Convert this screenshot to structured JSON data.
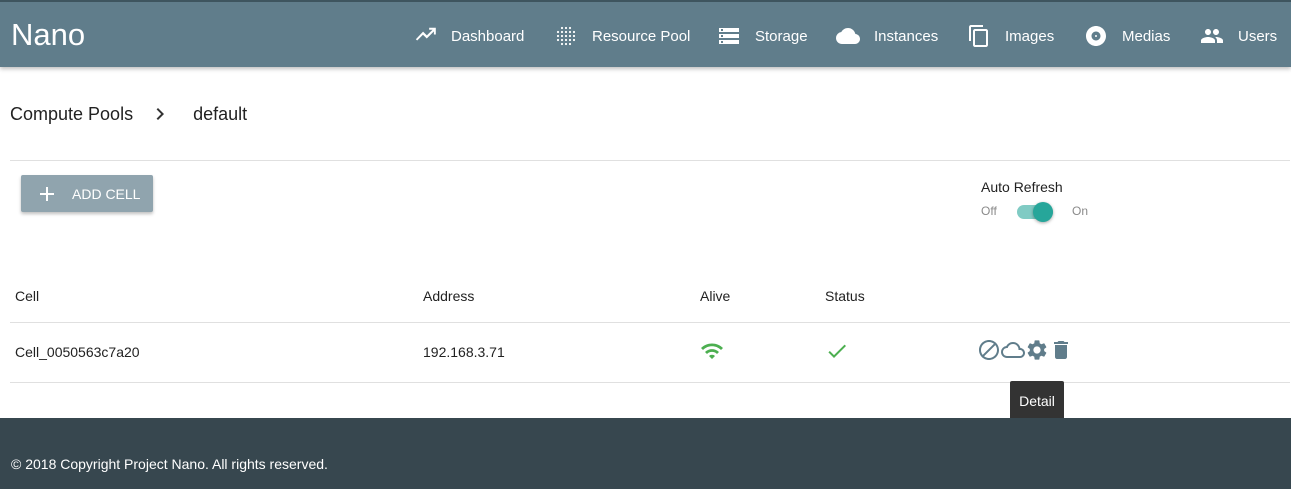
{
  "header": {
    "brand": "Nano",
    "nav": [
      {
        "label": "Dashboard",
        "icon": "trending-icon"
      },
      {
        "label": "Resource Pool",
        "icon": "grid-dots-icon"
      },
      {
        "label": "Storage",
        "icon": "storage-icon"
      },
      {
        "label": "Instances",
        "icon": "cloud-icon"
      },
      {
        "label": "Images",
        "icon": "copy-icon"
      },
      {
        "label": "Medias",
        "icon": "disc-icon"
      },
      {
        "label": "Users",
        "icon": "people-icon"
      }
    ]
  },
  "breadcrumb": {
    "root": "Compute Pools",
    "current": "default"
  },
  "toolbar": {
    "add_label": "ADD CELL",
    "auto_refresh": {
      "label": "Auto Refresh",
      "off_label": "Off",
      "on_label": "On",
      "enabled": true
    }
  },
  "table": {
    "headers": {
      "cell": "Cell",
      "address": "Address",
      "alive": "Alive",
      "status": "Status"
    },
    "rows": [
      {
        "cell": "Cell_0050563c7a20",
        "address": "192.168.3.71",
        "alive_icon": "wifi-icon",
        "status_icon": "check-icon",
        "actions": [
          "disable-icon",
          "cloud-outline-icon",
          "gear-icon",
          "trash-icon"
        ]
      }
    ]
  },
  "tooltip": {
    "text": "Detail"
  },
  "footer": {
    "copyright": "© 2018 Copyright Project Nano. All rights reserved."
  },
  "colors": {
    "header_bg": "#607d8b",
    "footer_bg": "#37474f",
    "button_bg": "#90a4ae",
    "switch_accent": "#26a69a",
    "alive_green": "#4caf50",
    "action_icon": "#607d8b"
  }
}
